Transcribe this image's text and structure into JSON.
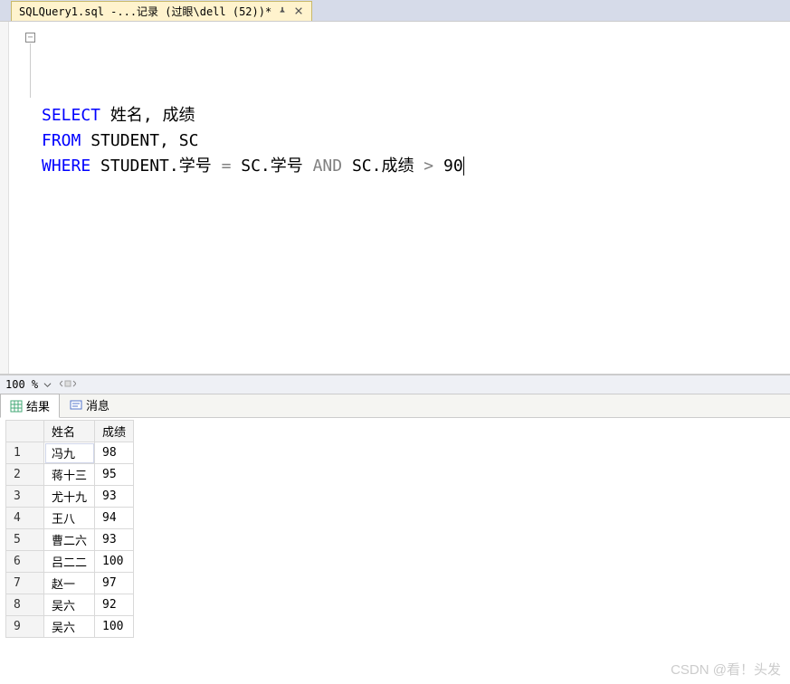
{
  "tab": {
    "title": "SQLQuery1.sql -...记录 (过眼\\dell (52))*"
  },
  "sql": {
    "line1_kw": "SELECT",
    "line1_rest": " 姓名, 成绩",
    "line2_kw": "FROM",
    "line2_rest": " STUDENT, SC",
    "line3_kw": "WHERE",
    "line3_mid": " STUDENT.学号 ",
    "line3_eq": "=",
    "line3_mid2": " SC.学号 ",
    "line3_and": "AND",
    "line3_mid3": " SC.成绩 ",
    "line3_gt": ">",
    "line3_num": " 90"
  },
  "zoom": {
    "value": "100 %"
  },
  "result_tabs": {
    "results": "结果",
    "messages": "消息"
  },
  "grid": {
    "headers": [
      "姓名",
      "成绩"
    ],
    "rows": [
      {
        "n": "1",
        "c0": "冯九",
        "c1": "98"
      },
      {
        "n": "2",
        "c0": "蒋十三",
        "c1": "95"
      },
      {
        "n": "3",
        "c0": "尤十九",
        "c1": "93"
      },
      {
        "n": "4",
        "c0": "王八",
        "c1": "94"
      },
      {
        "n": "5",
        "c0": "曹二六",
        "c1": "93"
      },
      {
        "n": "6",
        "c0": "吕二二",
        "c1": "100"
      },
      {
        "n": "7",
        "c0": "赵一",
        "c1": "97"
      },
      {
        "n": "8",
        "c0": "吴六",
        "c1": "92"
      },
      {
        "n": "9",
        "c0": "吴六",
        "c1": "100"
      }
    ]
  },
  "watermark": "CSDN @看！头发"
}
